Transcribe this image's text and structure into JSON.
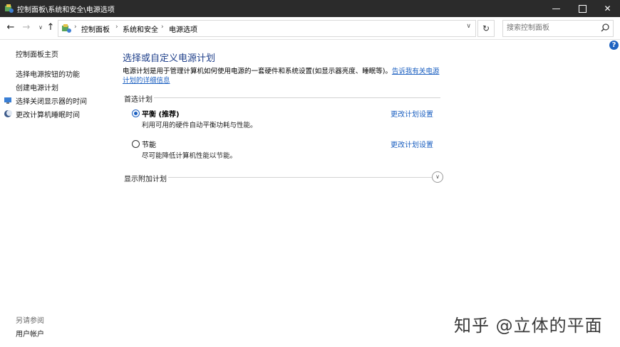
{
  "window": {
    "title": "控制面板\\系统和安全\\电源选项",
    "minimize_glyph": "—",
    "close_glyph": "✕"
  },
  "nav": {
    "back_glyph": "←",
    "forward_glyph": "→",
    "recent_glyph": "∨",
    "up_glyph": "↑",
    "refresh_glyph": "↻",
    "dropdown_glyph": "∨",
    "breadcrumb_sep": "›",
    "breadcrumb": [
      "控制面板",
      "系统和安全",
      "电源选项"
    ],
    "search_placeholder": "搜索控制面板"
  },
  "sidebar": {
    "home": "控制面板主页",
    "links": [
      "选择电源按钮的功能",
      "创建电源计划",
      "选择关闭显示器的时间",
      "更改计算机睡眠时间"
    ],
    "see_also_heading": "另请参阅",
    "see_also_links": [
      "用户帐户"
    ]
  },
  "help_glyph": "?",
  "main": {
    "title": "选择或自定义电源计划",
    "description": "电源计划是用于管理计算机如何使用电源的一套硬件和系统设置(如显示器亮度、睡眠等)。",
    "description_link": "告诉我有关电源计划的详细信息",
    "preferred_label": "首选计划",
    "plans": [
      {
        "name": "平衡 (推荐)",
        "desc": "利用可用的硬件自动平衡功耗与性能。",
        "link": "更改计划设置",
        "selected": true
      },
      {
        "name": "节能",
        "desc": "尽可能降低计算机性能以节能。",
        "link": "更改计划设置",
        "selected": false
      }
    ],
    "show_more": "显示附加计划",
    "expand_glyph": "∨"
  },
  "watermark": "知乎 @立体的平面",
  "colors": {
    "titlebar": "#2b2b2b",
    "link": "#1b5fc0",
    "heading": "#1e3f8a"
  }
}
